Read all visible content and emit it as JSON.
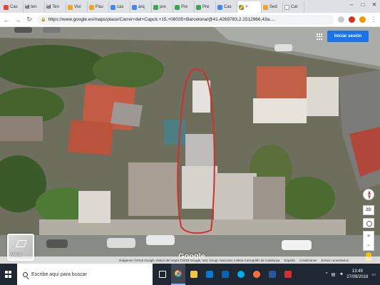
{
  "browser": {
    "tabs": [
      {
        "label": "Cas",
        "icon": "red-favicon"
      },
      {
        "label": "ten",
        "icon": "id-favicon"
      },
      {
        "label": "Ten",
        "icon": "id-favicon"
      },
      {
        "label": "Vivi",
        "icon": "orange-favicon"
      },
      {
        "label": "Pau",
        "icon": "orange-favicon"
      },
      {
        "label": "cas",
        "icon": "google-favicon"
      },
      {
        "label": "arq",
        "icon": "google-favicon"
      },
      {
        "label": "pre",
        "icon": "green-favicon"
      },
      {
        "label": "Pre",
        "icon": "green-favicon"
      },
      {
        "label": "Pre",
        "icon": "green-favicon"
      },
      {
        "label": "Cas",
        "icon": "blue-favicon"
      },
      {
        "label": "",
        "icon": "maps-favicon",
        "active": true
      },
      {
        "label": "Sed",
        "icon": "orange-favicon"
      },
      {
        "label": "Car",
        "icon": "white-favicon"
      }
    ],
    "url": "https://www.google.es/maps/place/Carrer+del+Capcir,+15,+08035+Barcelona/@41.4269783,2.1512966,43a...."
  },
  "map": {
    "signin_label": "Iniciar sesión",
    "layer_label": "Mapa",
    "google_logo": "Google",
    "tilt_label": "2D",
    "attribution": {
      "imagery": "Imágenes ©2018 Google, Datos del mapa ©2018 Google, Inst. Geogr. Nacional, Institut Cartogràfic de Catalunya",
      "country": "España",
      "terms": "Condiciones",
      "feedback": "Enviar comentarios"
    },
    "accent_color": "#1a73e8",
    "highlight_color": "#d32f2f"
  },
  "taskbar": {
    "search_placeholder": "Escribe aquí para buscar",
    "time": "13:49",
    "date": "27/09/2018",
    "apps": [
      "task-view",
      "chrome",
      "file-explorer",
      "mail",
      "outlook",
      "skype",
      "firefox",
      "word",
      "acrobat"
    ]
  }
}
